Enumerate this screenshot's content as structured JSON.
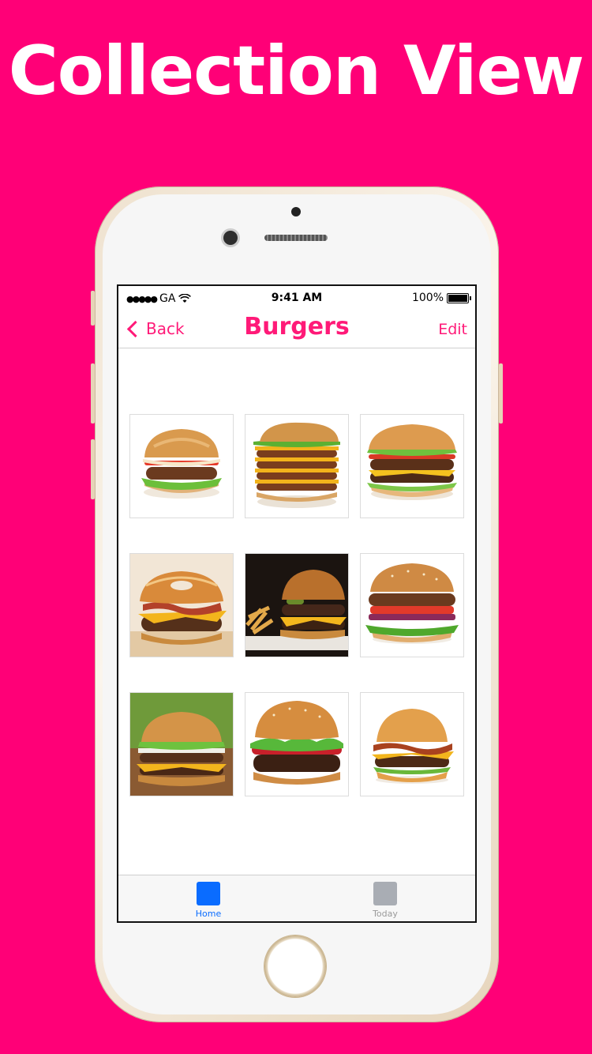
{
  "headline": "Collection View",
  "status": {
    "carrier": "GA",
    "time": "9:41 AM",
    "battery": "100%"
  },
  "nav": {
    "back_label": "Back",
    "title": "Burgers",
    "edit_label": "Edit"
  },
  "grid_items": [
    "burger-1",
    "burger-2",
    "burger-3",
    "burger-4",
    "burger-5",
    "burger-6",
    "burger-7",
    "burger-8",
    "burger-9"
  ],
  "tabs": [
    {
      "label": "Home",
      "color": "#0a6cff",
      "label_color": "#0a6cff"
    },
    {
      "label": "Today",
      "color": "#a9adb4",
      "label_color": "#9a9a9a"
    }
  ],
  "colors": {
    "background": "#ff0077",
    "accent": "#ff1a78"
  }
}
